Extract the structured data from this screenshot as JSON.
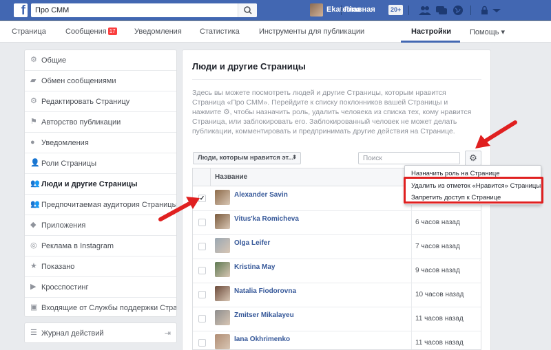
{
  "topbar": {
    "logo": "f",
    "search_value": "Про СММ",
    "user_name": "Ekaterina",
    "home_label": "Главная",
    "home_badge": "20+"
  },
  "pagenav": {
    "tabs": [
      {
        "label": "Страница"
      },
      {
        "label": "Сообщения",
        "badge": "17"
      },
      {
        "label": "Уведомления"
      },
      {
        "label": "Статистика"
      },
      {
        "label": "Инструменты для публикации"
      },
      {
        "label": "Настройки",
        "active": true
      },
      {
        "label": "Помощь ▾"
      }
    ]
  },
  "sidebar": {
    "items": [
      {
        "label": "Общие",
        "icon": "gear-icon"
      },
      {
        "label": "Обмен сообщениями",
        "icon": "chat-icon"
      },
      {
        "label": "Редактировать Страницу",
        "icon": "gear-icon"
      },
      {
        "label": "Авторство публикации",
        "icon": "flag-icon"
      },
      {
        "label": "Уведомления",
        "icon": "globe-icon"
      },
      {
        "label": "Роли Страницы",
        "icon": "person-icon"
      },
      {
        "label": "Люди и другие Страницы",
        "icon": "people-icon",
        "active": true
      },
      {
        "label": "Предпочитаемая аудитория Страницы",
        "icon": "people-icon"
      },
      {
        "label": "Приложения",
        "icon": "cube-icon"
      },
      {
        "label": "Реклама в Instagram",
        "icon": "instagram-icon"
      },
      {
        "label": "Показано",
        "icon": "star-icon"
      },
      {
        "label": "Кросспостинг",
        "icon": "video-icon"
      },
      {
        "label": "Входящие от Службы поддержки Стран",
        "icon": "facebook-icon"
      }
    ],
    "journal_label": "Журнал действий"
  },
  "main": {
    "title": "Люди и другие Страницы",
    "description": "Здесь вы можете посмотреть людей и другие Страницы, которым нравится Страница «Про СММ». Перейдите к списку поклонников вашей Страницы и нажмите ⚙, чтобы назначить роль, удалить человека из списка тех, кому нравится Страница, или заблокировать его. Заблокированный человек не может делать публикации, комментировать и предпринимать другие действия на Странице.",
    "filter_label": "Люди, которым нравится эт...",
    "search_placeholder": "Поиск",
    "column_name": "Название"
  },
  "dropdown": {
    "items": [
      "Назначить роль на Странице",
      "Удалить из отметок «Нравится» Страницы",
      "Запретить доступ к Странице"
    ]
  },
  "people": [
    {
      "name": "Alexander Savin",
      "time": "",
      "checked": true,
      "avatar_color": "#8d6b4a"
    },
    {
      "name": "Vitus'ka Romicheva",
      "time": "6 часов назад",
      "checked": false,
      "avatar_color": "#7a5a3c"
    },
    {
      "name": "Olga Leifer",
      "time": "7 часов назад",
      "checked": false,
      "avatar_color": "#9aa7b3"
    },
    {
      "name": "Kristina May",
      "time": "9 часов назад",
      "checked": false,
      "avatar_color": "#5e7a52"
    },
    {
      "name": "Natalia Fiodorovna",
      "time": "10 часов назад",
      "checked": false,
      "avatar_color": "#6b4a3a"
    },
    {
      "name": "Zmitser Mikalayeu",
      "time": "11 часов назад",
      "checked": false,
      "avatar_color": "#8e8e8e"
    },
    {
      "name": "Iana Okhrimenko",
      "time": "11 часов назад",
      "checked": false,
      "avatar_color": "#b08d74"
    }
  ]
}
